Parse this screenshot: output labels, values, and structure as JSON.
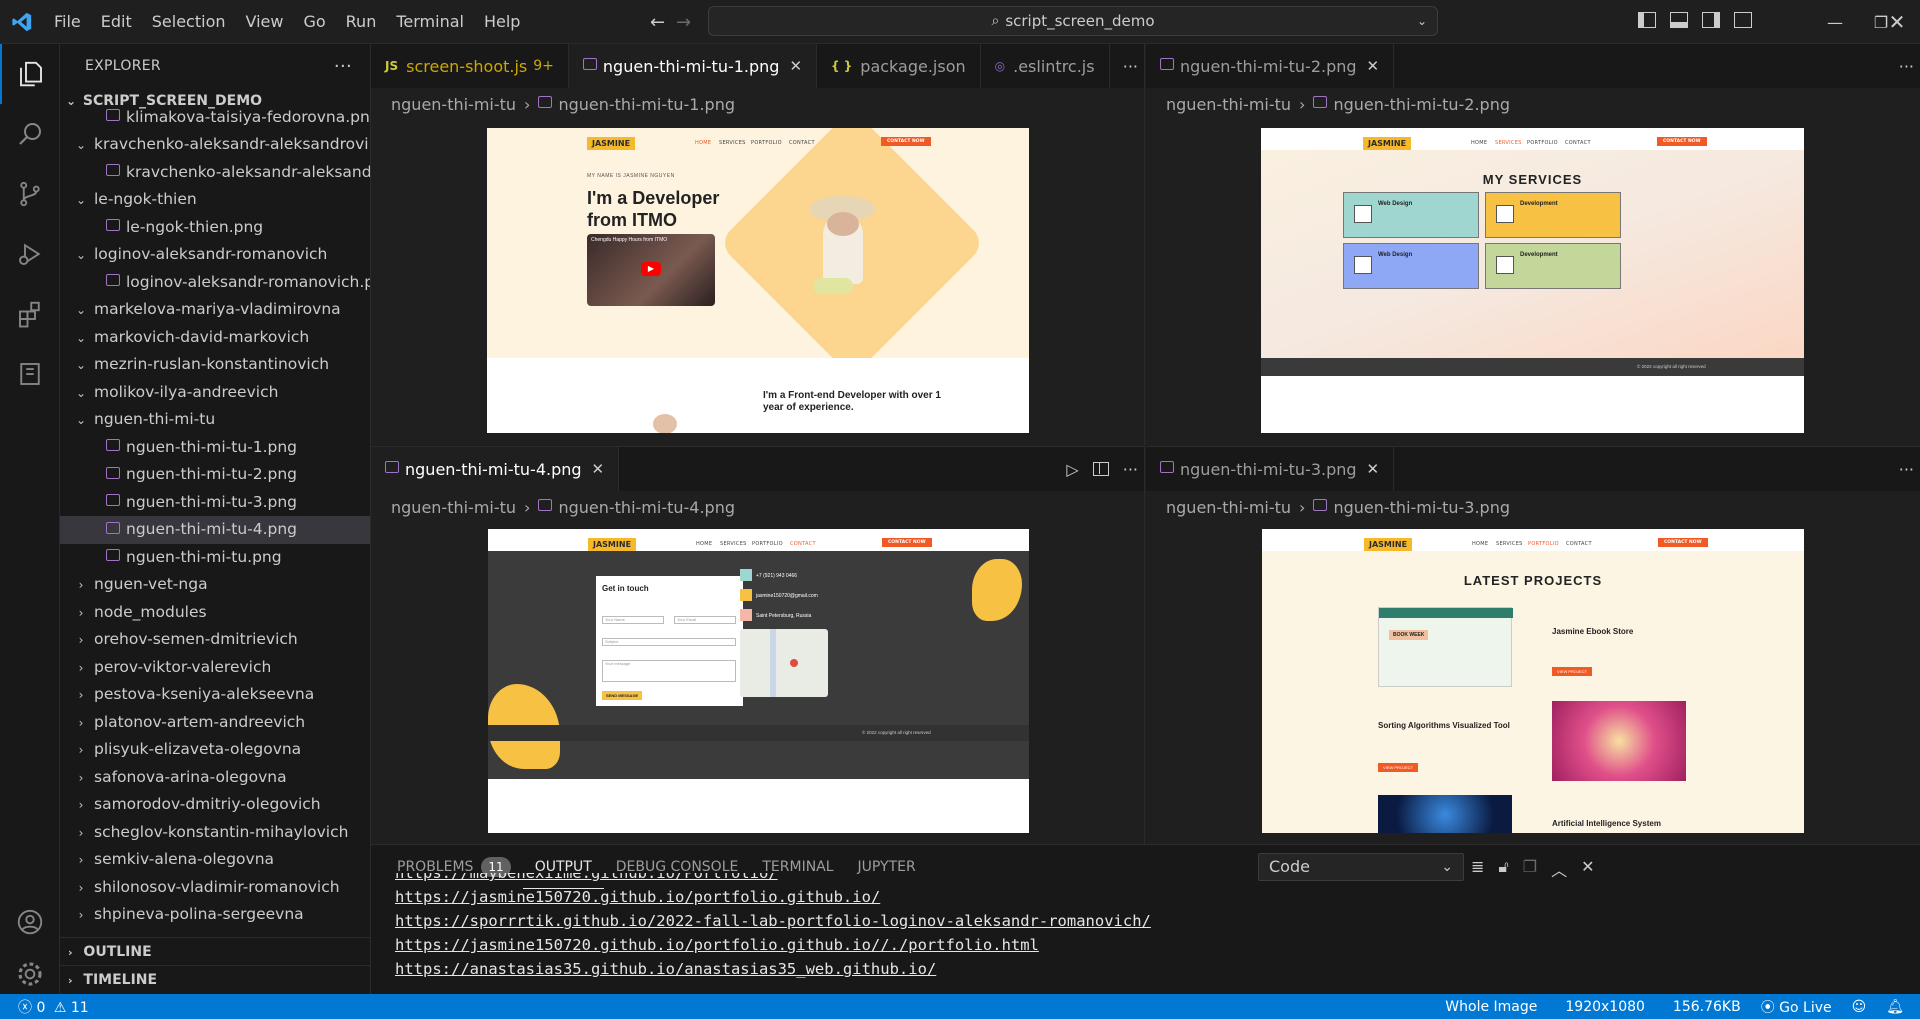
{
  "menu": [
    "File",
    "Edit",
    "Selection",
    "View",
    "Go",
    "Run",
    "Terminal",
    "Help"
  ],
  "command_center": "script_screen_demo",
  "explorer": {
    "header": "EXPLORER",
    "root": "SCRIPT_SCREEN_DEMO",
    "rows": [
      {
        "label": "klimakova-taisiya-fedorovna.png",
        "indent": 2,
        "kind": "file"
      },
      {
        "label": "kravchenko-aleksandr-aleksandrovi...",
        "indent": 1,
        "kind": "open"
      },
      {
        "label": "kravchenko-aleksandr-aleksandro...",
        "indent": 2,
        "kind": "file"
      },
      {
        "label": "le-ngok-thien",
        "indent": 1,
        "kind": "open"
      },
      {
        "label": "le-ngok-thien.png",
        "indent": 2,
        "kind": "file"
      },
      {
        "label": "loginov-aleksandr-romanovich",
        "indent": 1,
        "kind": "open"
      },
      {
        "label": "loginov-aleksandr-romanovich.png",
        "indent": 2,
        "kind": "file"
      },
      {
        "label": "markelova-mariya-vladimirovna",
        "indent": 1,
        "kind": "open"
      },
      {
        "label": "markovich-david-markovich",
        "indent": 1,
        "kind": "open"
      },
      {
        "label": "mezrin-ruslan-konstantinovich",
        "indent": 1,
        "kind": "open"
      },
      {
        "label": "molikov-ilya-andreevich",
        "indent": 1,
        "kind": "open"
      },
      {
        "label": "nguen-thi-mi-tu",
        "indent": 1,
        "kind": "open"
      },
      {
        "label": "nguen-thi-mi-tu-1.png",
        "indent": 2,
        "kind": "file"
      },
      {
        "label": "nguen-thi-mi-tu-2.png",
        "indent": 2,
        "kind": "file"
      },
      {
        "label": "nguen-thi-mi-tu-3.png",
        "indent": 2,
        "kind": "file"
      },
      {
        "label": "nguen-thi-mi-tu-4.png",
        "indent": 2,
        "kind": "file",
        "selected": true
      },
      {
        "label": "nguen-thi-mi-tu.png",
        "indent": 2,
        "kind": "file"
      },
      {
        "label": "nguen-vet-nga",
        "indent": 1,
        "kind": "closed"
      },
      {
        "label": "node_modules",
        "indent": 1,
        "kind": "closed"
      },
      {
        "label": "orehov-semen-dmitrievich",
        "indent": 1,
        "kind": "closed"
      },
      {
        "label": "perov-viktor-valerevich",
        "indent": 1,
        "kind": "closed"
      },
      {
        "label": "pestova-kseniya-alekseevna",
        "indent": 1,
        "kind": "closed"
      },
      {
        "label": "platonov-artem-andreevich",
        "indent": 1,
        "kind": "closed"
      },
      {
        "label": "plisyuk-elizaveta-olegovna",
        "indent": 1,
        "kind": "closed"
      },
      {
        "label": "safonova-arina-olegovna",
        "indent": 1,
        "kind": "closed"
      },
      {
        "label": "samorodov-dmitriy-olegovich",
        "indent": 1,
        "kind": "closed"
      },
      {
        "label": "scheglov-konstantin-mihaylovich",
        "indent": 1,
        "kind": "closed"
      },
      {
        "label": "semkiv-alena-olegovna",
        "indent": 1,
        "kind": "closed"
      },
      {
        "label": "shilonosov-vladimir-romanovich",
        "indent": 1,
        "kind": "closed"
      },
      {
        "label": "shpineva-polina-sergeevna",
        "indent": 1,
        "kind": "closed"
      }
    ],
    "outline": "OUTLINE",
    "timeline": "TIMELINE"
  },
  "group1": {
    "tabs": [
      {
        "label": "screen-shoot.js",
        "badge": "9+",
        "kind": "js"
      },
      {
        "label": "nguen-thi-mi-tu-1.png",
        "kind": "png",
        "active": true
      },
      {
        "label": "package.json",
        "kind": "json"
      },
      {
        "label": ".eslintrc.js",
        "kind": "eslint"
      }
    ],
    "crumb_folder": "nguen-thi-mi-tu",
    "crumb_file": "nguen-thi-mi-tu-1.png"
  },
  "group2": {
    "tab": "nguen-thi-mi-tu-2.png",
    "crumb_folder": "nguen-thi-mi-tu",
    "crumb_file": "nguen-thi-mi-tu-2.png"
  },
  "group3": {
    "tab": "nguen-thi-mi-tu-4.png",
    "crumb_folder": "nguen-thi-mi-tu",
    "crumb_file": "nguen-thi-mi-tu-4.png"
  },
  "group4": {
    "tab": "nguen-thi-mi-tu-3.png",
    "crumb_folder": "nguen-thi-mi-tu",
    "crumb_file": "nguen-thi-mi-tu-3.png"
  },
  "site": {
    "logo": "JASMINE",
    "nav": [
      "HOME",
      "SERVICES",
      "PORTFOLIO",
      "CONTACT"
    ],
    "cta": "CONTACT NOW",
    "hero_kicker": "MY NAME IS JASMINE NGUYEN",
    "hero_title_1": "I'm a Developer",
    "hero_title_2": "from ITMO",
    "video_caption": "Chengdu Happy Hours from ITMO",
    "about": "I'm a Front-end Developer with over 1 year of experience.",
    "services_title": "MY SERVICES",
    "services": [
      {
        "title": "Web Design",
        "color": "#9fd6d0"
      },
      {
        "title": "Development",
        "color": "#f7c144"
      },
      {
        "title": "Web Design",
        "color": "#8ea8f5"
      },
      {
        "title": "Development",
        "color": "#c3d79b"
      }
    ],
    "footer": "© 2022 copyright all right reserved",
    "contact_title": "Get in touch",
    "contact_fields": [
      "Your Name",
      "Your Email",
      "Subject",
      "Your message"
    ],
    "contact_btn": "SEND MESSAGE",
    "phone": "+7 (921) 943 0466",
    "email": "jasmine150720@gmail.com",
    "address": "Saint Petersburg, Russia",
    "projects_title": "LATEST PROJECTS",
    "project1": "Jasmine Ebook Store",
    "project2": "Sorting Algorithms Visualized Tool",
    "project3": "Artificial Intelligence System",
    "view_project": "VIEW PROJECT",
    "book_week": "BOOK WEEK"
  },
  "panel": {
    "tabs": [
      {
        "label": "PROBLEMS",
        "badge": "11"
      },
      {
        "label": "OUTPUT",
        "active": true
      },
      {
        "label": "DEBUG CONSOLE"
      },
      {
        "label": "TERMINAL"
      },
      {
        "label": "JUPYTER"
      }
    ],
    "select": "Code",
    "lines": [
      "https://maybenexiime.github.io/Portfolio/",
      "https://jasmine150720.github.io/portfolio.github.io/",
      "https://sporrrtik.github.io/2022-fall-lab-portfolio-loginov-aleksandr-romanovich/",
      "https://jasmine150720.github.io/portfolio.github.io//./portfolio.html",
      "https://anastasias35.github.io/anastasias35_web.github.io/"
    ]
  },
  "status": {
    "errors": "0",
    "warnings": "11",
    "image_mode": "Whole Image",
    "dims": "1920x1080",
    "size": "156.76KB",
    "live": "Go Live"
  },
  "colors": {
    "accent": "#0078d4",
    "brand": "#f7b92c",
    "cta": "#f15a24"
  }
}
